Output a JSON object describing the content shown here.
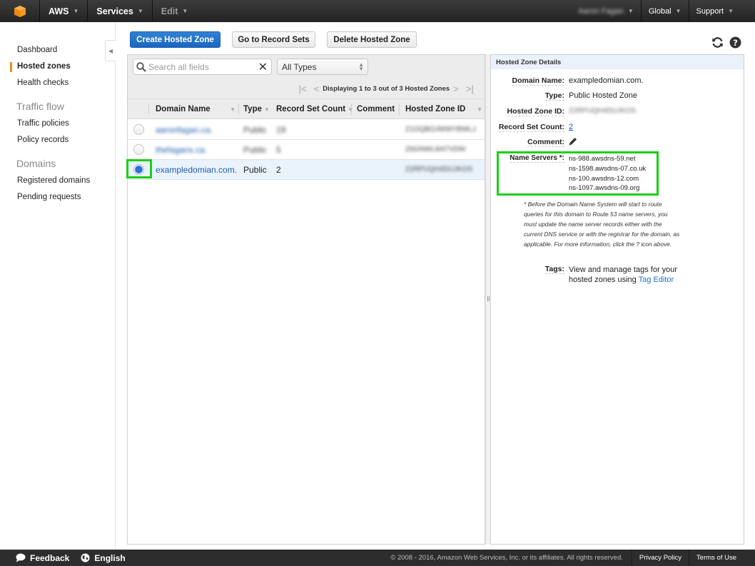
{
  "topnav": {
    "logo_icon": "aws-cube-icon",
    "aws_label": "AWS",
    "services_label": "Services",
    "edit_label": "Edit",
    "account_name": "Aaron Fagan",
    "region_label": "Global",
    "support_label": "Support"
  },
  "sidebar": {
    "items": [
      {
        "label": "Dashboard",
        "active": false
      },
      {
        "label": "Hosted zones",
        "active": true
      },
      {
        "label": "Health checks",
        "active": false
      }
    ],
    "sections": [
      {
        "title": "Traffic flow",
        "items": [
          {
            "label": "Traffic policies"
          },
          {
            "label": "Policy records"
          }
        ]
      },
      {
        "title": "Domains",
        "items": [
          {
            "label": "Registered domains"
          },
          {
            "label": "Pending requests"
          }
        ]
      }
    ],
    "collapse_icon": "chevron-left-icon"
  },
  "toolbar": {
    "create_label": "Create Hosted Zone",
    "goto_label": "Go to Record Sets",
    "delete_label": "Delete Hosted Zone",
    "refresh_icon": "refresh-icon",
    "help_icon": "help-icon"
  },
  "filter": {
    "search_placeholder": "Search all fields",
    "search_value": "",
    "type_selected": "All Types",
    "pager_text": "Displaying 1 to 3 out of 3 Hosted Zones"
  },
  "table": {
    "columns": [
      "Domain Name",
      "Type",
      "Record Set Count",
      "Comment",
      "Hosted Zone ID"
    ],
    "rows": [
      {
        "domain": "aaronfagan.ca.",
        "type": "Public",
        "count": "19",
        "comment": "",
        "zone_id": "Z1OQBOJWWYBWLJ",
        "selected": false,
        "blurred": true
      },
      {
        "domain": "thefagans.ca.",
        "type": "Public",
        "count": "5",
        "comment": "",
        "zone_id": "Z6GNWLM47VDW",
        "selected": false,
        "blurred": true
      },
      {
        "domain": "exampledomian.com.",
        "type": "Public",
        "count": "2",
        "comment": "",
        "zone_id": "Z2RPUQH4DUJKOS",
        "selected": true,
        "blurred": false
      }
    ]
  },
  "details": {
    "title": "Hosted Zone Details",
    "domain_name_label": "Domain Name:",
    "domain_name": "exampledomian.com.",
    "type_label": "Type:",
    "type": "Public Hosted Zone",
    "zone_id_label": "Hosted Zone ID:",
    "zone_id": "Z2RPUQH4DUJKOS",
    "record_count_label": "Record Set Count:",
    "record_count": "2",
    "comment_label": "Comment:",
    "comment_icon": "pencil-icon",
    "name_servers_label": "Name Servers *:",
    "name_servers": [
      "ns-988.awsdns-59.net",
      "ns-1598.awsdns-07.co.uk",
      "ns-100.awsdns-12.com",
      "ns-1097.awsdns-09.org"
    ],
    "note": "* Before the Domain Name System will start to route queries for this domain to Route 53 name servers, you must update the name server records either with the current DNS service or with the registrar for the domain, as applicable. For more information, click the ? icon above.",
    "tags_label": "Tags:",
    "tags_text": "View and manage tags for your hosted zones using",
    "tags_link": "Tag Editor"
  },
  "footer": {
    "feedback_label": "Feedback",
    "language_label": "English",
    "copyright": "© 2008 - 2016, Amazon Web Services, Inc. or its affiliates. All rights reserved.",
    "privacy_label": "Privacy Policy",
    "terms_label": "Terms of Use"
  },
  "colors": {
    "accent_orange": "#f08c1a",
    "primary_blue": "#1f6fc8",
    "highlight_green": "#19d114",
    "link_blue": "#1f5fae"
  }
}
